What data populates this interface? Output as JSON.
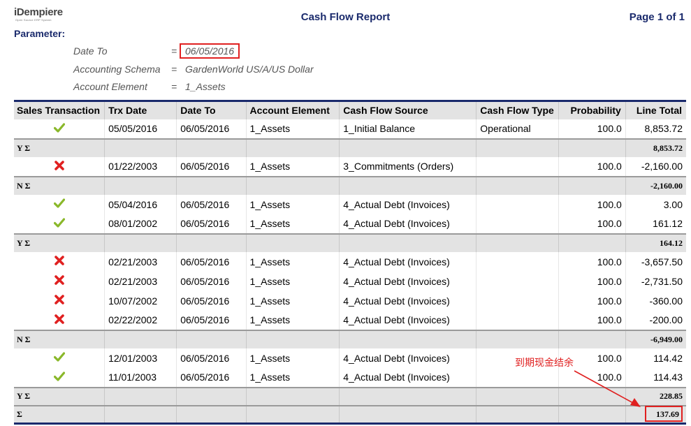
{
  "logo": {
    "brand": "iDempiere",
    "tagline": "Open Source ERP System"
  },
  "report": {
    "title": "Cash Flow Report",
    "page_info": "Page 1 of 1"
  },
  "parameters": {
    "heading": "Parameter:",
    "items": [
      {
        "name": "Date To",
        "eq": "=",
        "value": "06/05/2016"
      },
      {
        "name": "Accounting Schema",
        "eq": "=",
        "value": "GardenWorld US/A/US Dollar"
      },
      {
        "name": "Account Element",
        "eq": "=",
        "value": "1_Assets"
      }
    ]
  },
  "columns": [
    "Sales Transaction",
    "Trx Date",
    "Date To",
    "Account Element",
    "Cash Flow Source",
    "Cash Flow Type",
    "Probability",
    "Line Total"
  ],
  "rows": [
    {
      "kind": "data",
      "sales": "check",
      "trx_date": "05/05/2016",
      "date_to": "06/05/2016",
      "element": "1_Assets",
      "source": "1_Initial Balance",
      "type": "Operational",
      "prob": "100.0",
      "total": "8,853.72"
    },
    {
      "kind": "sum",
      "label": "Y Σ",
      "total": "8,853.72"
    },
    {
      "kind": "data",
      "sales": "cross",
      "trx_date": "01/22/2003",
      "date_to": "06/05/2016",
      "element": "1_Assets",
      "source": "3_Commitments (Orders)",
      "type": "",
      "prob": "100.0",
      "total": "-2,160.00"
    },
    {
      "kind": "sum",
      "label": "N Σ",
      "total": "-2,160.00"
    },
    {
      "kind": "data",
      "sales": "check",
      "trx_date": "05/04/2016",
      "date_to": "06/05/2016",
      "element": "1_Assets",
      "source": "4_Actual Debt (Invoices)",
      "type": "",
      "prob": "100.0",
      "total": "3.00"
    },
    {
      "kind": "data",
      "sales": "check",
      "trx_date": "08/01/2002",
      "date_to": "06/05/2016",
      "element": "1_Assets",
      "source": "4_Actual Debt (Invoices)",
      "type": "",
      "prob": "100.0",
      "total": "161.12"
    },
    {
      "kind": "sum",
      "label": "Y Σ",
      "total": "164.12"
    },
    {
      "kind": "data",
      "sales": "cross",
      "trx_date": "02/21/2003",
      "date_to": "06/05/2016",
      "element": "1_Assets",
      "source": "4_Actual Debt (Invoices)",
      "type": "",
      "prob": "100.0",
      "total": "-3,657.50"
    },
    {
      "kind": "data",
      "sales": "cross",
      "trx_date": "02/21/2003",
      "date_to": "06/05/2016",
      "element": "1_Assets",
      "source": "4_Actual Debt (Invoices)",
      "type": "",
      "prob": "100.0",
      "total": "-2,731.50"
    },
    {
      "kind": "data",
      "sales": "cross",
      "trx_date": "10/07/2002",
      "date_to": "06/05/2016",
      "element": "1_Assets",
      "source": "4_Actual Debt (Invoices)",
      "type": "",
      "prob": "100.0",
      "total": "-360.00"
    },
    {
      "kind": "data",
      "sales": "cross",
      "trx_date": "02/22/2002",
      "date_to": "06/05/2016",
      "element": "1_Assets",
      "source": "4_Actual Debt (Invoices)",
      "type": "",
      "prob": "100.0",
      "total": "-200.00"
    },
    {
      "kind": "sum",
      "label": "N Σ",
      "total": "-6,949.00"
    },
    {
      "kind": "data",
      "sales": "check",
      "trx_date": "12/01/2003",
      "date_to": "06/05/2016",
      "element": "1_Assets",
      "source": "4_Actual Debt (Invoices)",
      "type": "",
      "prob": "100.0",
      "total": "114.42"
    },
    {
      "kind": "data",
      "sales": "check",
      "trx_date": "11/01/2003",
      "date_to": "06/05/2016",
      "element": "1_Assets",
      "source": "4_Actual Debt (Invoices)",
      "type": "",
      "prob": "100.0",
      "total": "114.43"
    },
    {
      "kind": "sum",
      "label": "Y Σ",
      "total": "228.85"
    },
    {
      "kind": "grand",
      "label": "Σ",
      "total": "137.69"
    }
  ],
  "annotation": {
    "text": "到期现金结余"
  },
  "colors": {
    "header_text": "#1a2a6c",
    "check": "#8ab82a",
    "cross": "#e02020",
    "highlight": "#e02020",
    "band": "#e3e3e3"
  },
  "icons": {
    "check": "check-icon",
    "cross": "cross-icon"
  }
}
